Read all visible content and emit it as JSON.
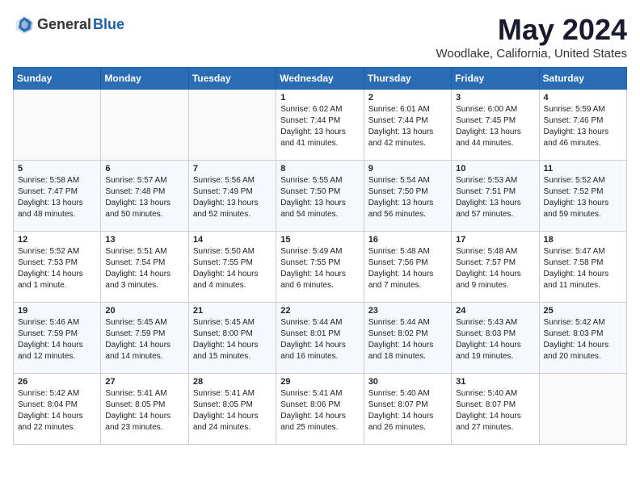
{
  "header": {
    "logo_general": "General",
    "logo_blue": "Blue",
    "title": "May 2024",
    "subtitle": "Woodlake, California, United States"
  },
  "weekdays": [
    "Sunday",
    "Monday",
    "Tuesday",
    "Wednesday",
    "Thursday",
    "Friday",
    "Saturday"
  ],
  "weeks": [
    [
      {
        "day": "",
        "info": ""
      },
      {
        "day": "",
        "info": ""
      },
      {
        "day": "",
        "info": ""
      },
      {
        "day": "1",
        "info": "Sunrise: 6:02 AM\nSunset: 7:44 PM\nDaylight: 13 hours\nand 41 minutes."
      },
      {
        "day": "2",
        "info": "Sunrise: 6:01 AM\nSunset: 7:44 PM\nDaylight: 13 hours\nand 42 minutes."
      },
      {
        "day": "3",
        "info": "Sunrise: 6:00 AM\nSunset: 7:45 PM\nDaylight: 13 hours\nand 44 minutes."
      },
      {
        "day": "4",
        "info": "Sunrise: 5:59 AM\nSunset: 7:46 PM\nDaylight: 13 hours\nand 46 minutes."
      }
    ],
    [
      {
        "day": "5",
        "info": "Sunrise: 5:58 AM\nSunset: 7:47 PM\nDaylight: 13 hours\nand 48 minutes."
      },
      {
        "day": "6",
        "info": "Sunrise: 5:57 AM\nSunset: 7:48 PM\nDaylight: 13 hours\nand 50 minutes."
      },
      {
        "day": "7",
        "info": "Sunrise: 5:56 AM\nSunset: 7:49 PM\nDaylight: 13 hours\nand 52 minutes."
      },
      {
        "day": "8",
        "info": "Sunrise: 5:55 AM\nSunset: 7:50 PM\nDaylight: 13 hours\nand 54 minutes."
      },
      {
        "day": "9",
        "info": "Sunrise: 5:54 AM\nSunset: 7:50 PM\nDaylight: 13 hours\nand 56 minutes."
      },
      {
        "day": "10",
        "info": "Sunrise: 5:53 AM\nSunset: 7:51 PM\nDaylight: 13 hours\nand 57 minutes."
      },
      {
        "day": "11",
        "info": "Sunrise: 5:52 AM\nSunset: 7:52 PM\nDaylight: 13 hours\nand 59 minutes."
      }
    ],
    [
      {
        "day": "12",
        "info": "Sunrise: 5:52 AM\nSunset: 7:53 PM\nDaylight: 14 hours\nand 1 minute."
      },
      {
        "day": "13",
        "info": "Sunrise: 5:51 AM\nSunset: 7:54 PM\nDaylight: 14 hours\nand 3 minutes."
      },
      {
        "day": "14",
        "info": "Sunrise: 5:50 AM\nSunset: 7:55 PM\nDaylight: 14 hours\nand 4 minutes."
      },
      {
        "day": "15",
        "info": "Sunrise: 5:49 AM\nSunset: 7:55 PM\nDaylight: 14 hours\nand 6 minutes."
      },
      {
        "day": "16",
        "info": "Sunrise: 5:48 AM\nSunset: 7:56 PM\nDaylight: 14 hours\nand 7 minutes."
      },
      {
        "day": "17",
        "info": "Sunrise: 5:48 AM\nSunset: 7:57 PM\nDaylight: 14 hours\nand 9 minutes."
      },
      {
        "day": "18",
        "info": "Sunrise: 5:47 AM\nSunset: 7:58 PM\nDaylight: 14 hours\nand 11 minutes."
      }
    ],
    [
      {
        "day": "19",
        "info": "Sunrise: 5:46 AM\nSunset: 7:59 PM\nDaylight: 14 hours\nand 12 minutes."
      },
      {
        "day": "20",
        "info": "Sunrise: 5:45 AM\nSunset: 7:59 PM\nDaylight: 14 hours\nand 14 minutes."
      },
      {
        "day": "21",
        "info": "Sunrise: 5:45 AM\nSunset: 8:00 PM\nDaylight: 14 hours\nand 15 minutes."
      },
      {
        "day": "22",
        "info": "Sunrise: 5:44 AM\nSunset: 8:01 PM\nDaylight: 14 hours\nand 16 minutes."
      },
      {
        "day": "23",
        "info": "Sunrise: 5:44 AM\nSunset: 8:02 PM\nDaylight: 14 hours\nand 18 minutes."
      },
      {
        "day": "24",
        "info": "Sunrise: 5:43 AM\nSunset: 8:03 PM\nDaylight: 14 hours\nand 19 minutes."
      },
      {
        "day": "25",
        "info": "Sunrise: 5:42 AM\nSunset: 8:03 PM\nDaylight: 14 hours\nand 20 minutes."
      }
    ],
    [
      {
        "day": "26",
        "info": "Sunrise: 5:42 AM\nSunset: 8:04 PM\nDaylight: 14 hours\nand 22 minutes."
      },
      {
        "day": "27",
        "info": "Sunrise: 5:41 AM\nSunset: 8:05 PM\nDaylight: 14 hours\nand 23 minutes."
      },
      {
        "day": "28",
        "info": "Sunrise: 5:41 AM\nSunset: 8:05 PM\nDaylight: 14 hours\nand 24 minutes."
      },
      {
        "day": "29",
        "info": "Sunrise: 5:41 AM\nSunset: 8:06 PM\nDaylight: 14 hours\nand 25 minutes."
      },
      {
        "day": "30",
        "info": "Sunrise: 5:40 AM\nSunset: 8:07 PM\nDaylight: 14 hours\nand 26 minutes."
      },
      {
        "day": "31",
        "info": "Sunrise: 5:40 AM\nSunset: 8:07 PM\nDaylight: 14 hours\nand 27 minutes."
      },
      {
        "day": "",
        "info": ""
      }
    ]
  ]
}
